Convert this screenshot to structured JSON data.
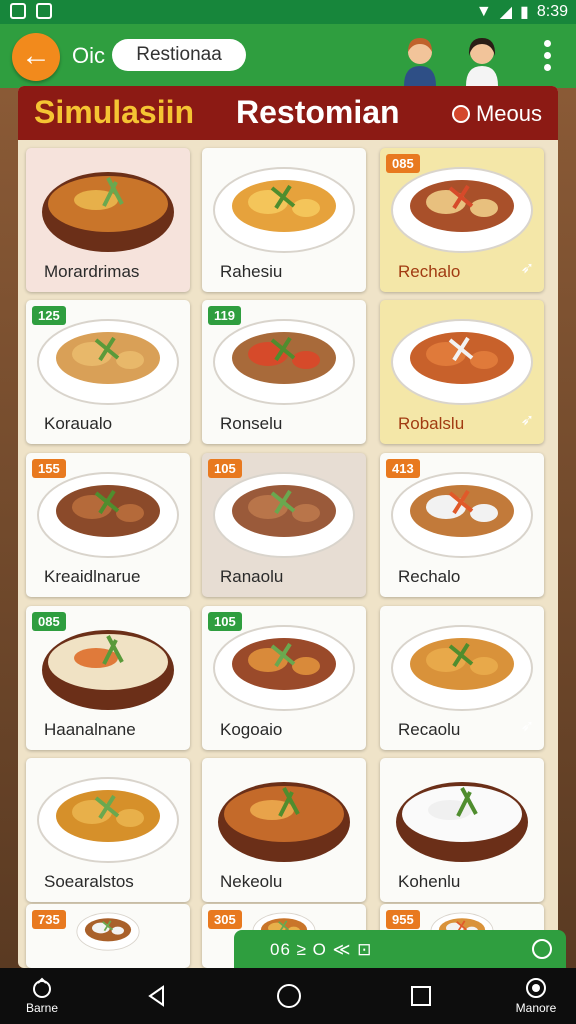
{
  "status_bar": {
    "time": "8:39"
  },
  "app_bar": {
    "title": "Oic",
    "search_value": "Restionaa"
  },
  "banner": {
    "title_part1": "Simulasiin",
    "title_part2": "Restomian",
    "menu_label": "Meous"
  },
  "menu": [
    {
      "name": "Morardrimas",
      "price": "",
      "tone": "pink"
    },
    {
      "name": "Rahesiu",
      "price": "",
      "tone": "white"
    },
    {
      "name": "Rechalo",
      "price": "085",
      "tone": "yellow"
    },
    {
      "name": "Koraualo",
      "price": "125",
      "tone": "white"
    },
    {
      "name": "Ronselu",
      "price": "119",
      "tone": "white"
    },
    {
      "name": "Robalslu",
      "price": "",
      "tone": "yellow"
    },
    {
      "name": "Kreaidlnarue",
      "price": "155",
      "tone": "white"
    },
    {
      "name": "Ranaolu",
      "price": "105",
      "tone": "gray"
    },
    {
      "name": "Rechalo",
      "price": "413",
      "tone": "white"
    },
    {
      "name": "Haanalnane",
      "price": "085",
      "tone": "white"
    },
    {
      "name": "Kogoaio",
      "price": "105",
      "tone": "white"
    },
    {
      "name": "Recaolu",
      "price": "",
      "tone": "white"
    },
    {
      "name": "Soearalstos",
      "price": "",
      "tone": "white"
    },
    {
      "name": "Nekeolu",
      "price": "",
      "tone": "white"
    },
    {
      "name": "Kohenlu",
      "price": "",
      "tone": "white"
    },
    {
      "name": "",
      "price": "735",
      "tone": "white"
    },
    {
      "name": "",
      "price": "305",
      "tone": "white"
    },
    {
      "name": "",
      "price": "955",
      "tone": "white"
    }
  ],
  "bottom_bar": {
    "text": "06 ≥ O ≪ ⊡"
  },
  "nav": {
    "left_label": "Barne",
    "right_label": "Manore"
  },
  "colors": {
    "status": "#17863b",
    "app_bar": "#2f9e3f",
    "back_button": "#f28a1c",
    "banner": "#8c1a14",
    "banner_gold": "#f5c433"
  }
}
